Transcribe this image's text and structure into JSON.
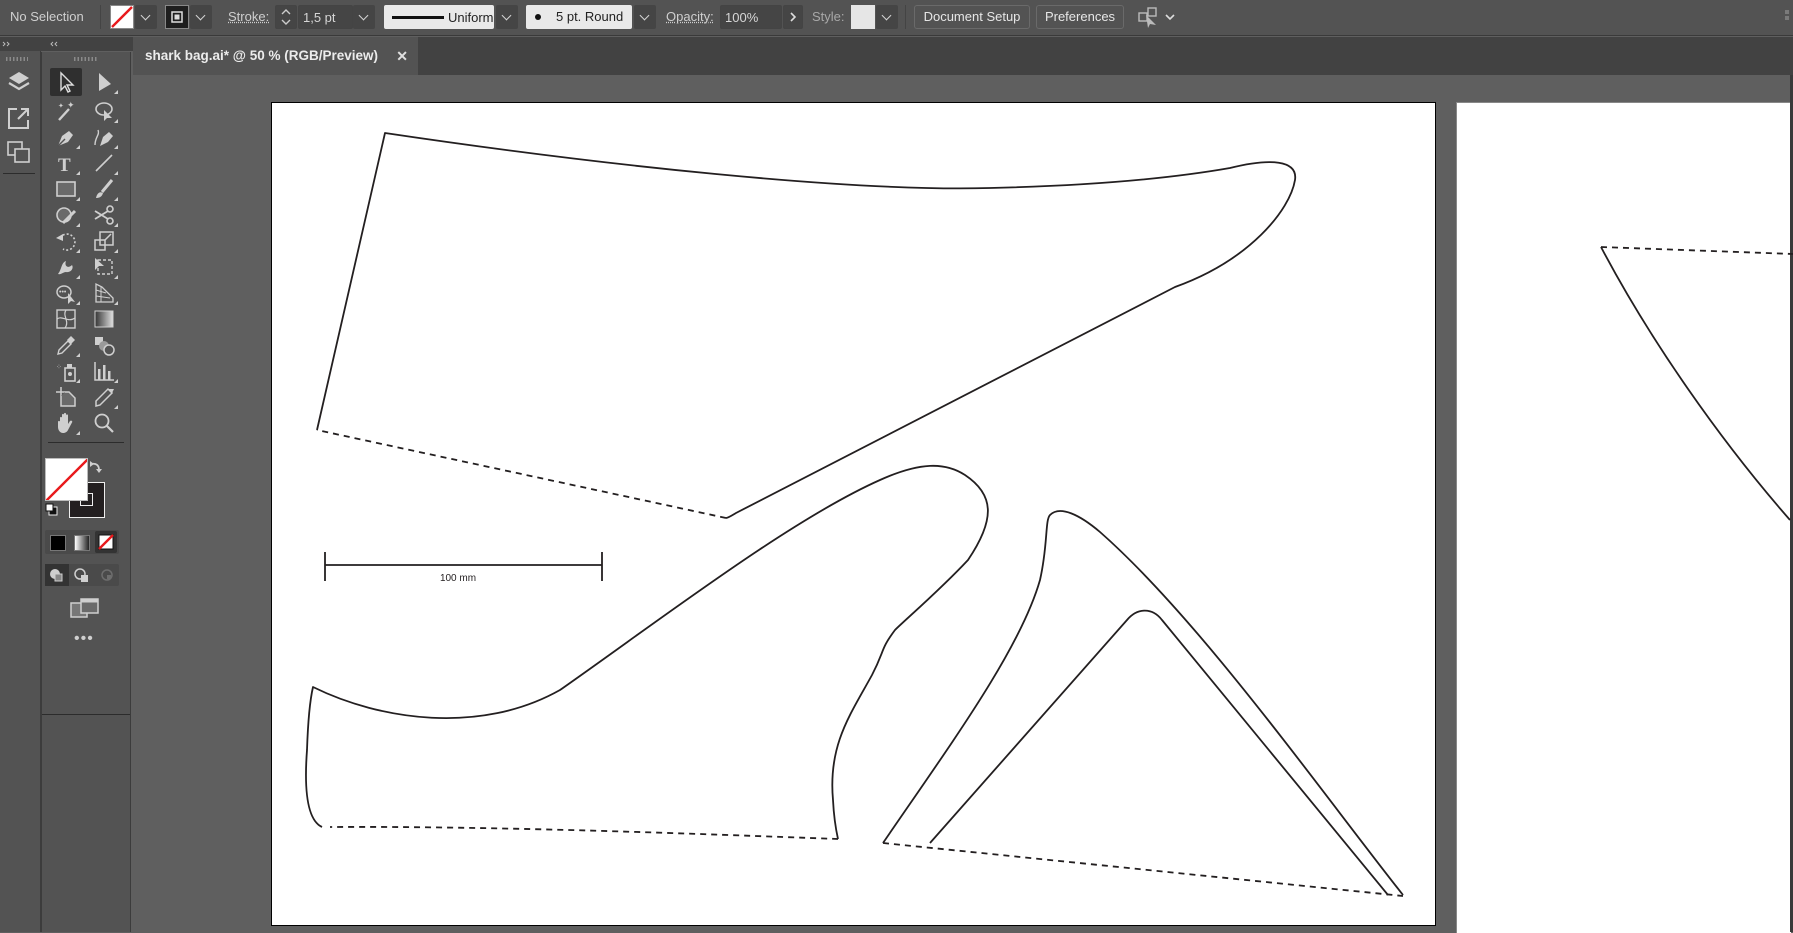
{
  "control_bar": {
    "selection_status": "No Selection",
    "fill": {
      "state": "none",
      "icon": "fill-none-swatch"
    },
    "stroke_swatch": {
      "icon": "stroke-swatch"
    },
    "stroke_label": "Stroke:",
    "stroke_weight": "1,5 pt",
    "variable_width_profile": "Uniform",
    "brush_definition": "5 pt. Round",
    "opacity_label": "Opacity:",
    "opacity_value": "100%",
    "style_label": "Style:",
    "document_setup_label": "Document Setup",
    "preferences_label": "Preferences",
    "arrange_icon": "arrange-documents-icon"
  },
  "document_tab": {
    "title": "shark bag.ai* @ 50 % (RGB/Preview)",
    "close_icon": "close-icon"
  },
  "left_panel_dock": {
    "items": [
      "layers-icon",
      "export-icon",
      "artboards-icon"
    ]
  },
  "tools": [
    [
      "selection-tool",
      "direct-selection-tool"
    ],
    [
      "magic-wand-tool",
      "lasso-tool"
    ],
    [
      "pen-tool",
      "curvature-tool"
    ],
    [
      "type-tool",
      "line-segment-tool"
    ],
    [
      "rectangle-tool",
      "paintbrush-tool"
    ],
    [
      "shaper-tool",
      "scissors-tool"
    ],
    [
      "rotate-tool",
      "scale-tool"
    ],
    [
      "puppet-warp-tool",
      "free-transform-tool"
    ],
    [
      "shape-builder-tool",
      "perspective-grid-tool"
    ],
    [
      "mesh-tool",
      "gradient-tool"
    ],
    [
      "eyedropper-tool",
      "blend-tool"
    ],
    [
      "symbol-sprayer-tool",
      "column-graph-tool"
    ],
    [
      "artboard-tool",
      "slice-tool"
    ],
    [
      "hand-tool",
      "zoom-tool"
    ]
  ],
  "colors": {
    "fill_none_red": "#e8191c",
    "stroke_dark": "#231f20",
    "ui_bg": "#535353",
    "canvas_bg": "#5f5f5f"
  },
  "artwork": {
    "scale_bar_label": "100 mm"
  }
}
